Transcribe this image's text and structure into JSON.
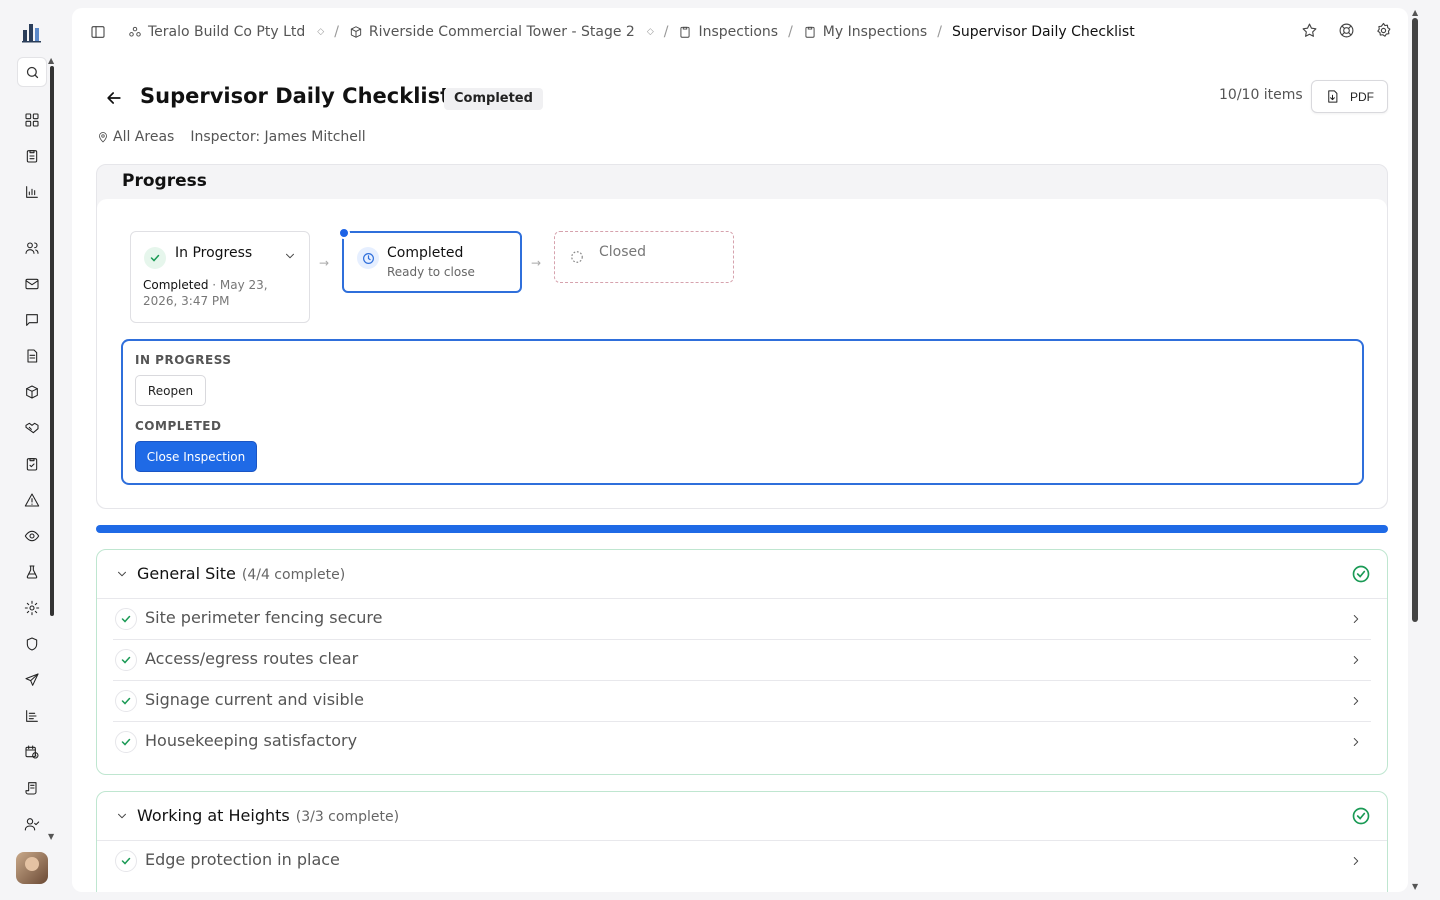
{
  "breadcrumbs": [
    {
      "label": "Teralo Build Co Pty Ltd",
      "icon": "org-icon",
      "selector": true
    },
    {
      "label": "Riverside Commercial Tower - Stage 2",
      "icon": "project-icon",
      "selector": true
    },
    {
      "label": "Inspections",
      "icon": "clipboard-icon"
    },
    {
      "label": "My Inspections",
      "icon": "clipboard-icon"
    },
    {
      "label": "Supervisor Daily Checklist",
      "current": true
    }
  ],
  "header": {
    "title": "Supervisor Daily Checklist",
    "status_badge": "Completed",
    "location": "All Areas",
    "inspector": "Inspector: James Mitchell",
    "item_count": "10/10 items",
    "pdf_label": "PDF"
  },
  "progress": {
    "heading": "Progress",
    "steps": [
      {
        "label": "In Progress",
        "sub_strong": "Completed",
        "sub_rest": " · May 23, 2026, 3:47 PM",
        "state": "done"
      },
      {
        "label": "Completed",
        "sub": "Ready to close",
        "state": "current"
      },
      {
        "label": "Closed",
        "state": "pending"
      }
    ],
    "action_groups": [
      {
        "heading": "IN PROGRESS",
        "button": "Reopen"
      },
      {
        "heading": "COMPLETED",
        "button": "Close Inspection"
      }
    ],
    "completion_fraction": 1.0
  },
  "sections": [
    {
      "title": "General Site",
      "count": "(4/4 complete)",
      "items": [
        "Site perimeter fencing secure",
        "Access/egress routes clear",
        "Signage current and visible",
        "Housekeeping satisfactory"
      ]
    },
    {
      "title": "Working at Heights",
      "count": "(3/3 complete)",
      "items": [
        "Edge protection in place"
      ]
    }
  ],
  "colors": {
    "accent": "#1f6ae6",
    "success": "#1a9a55",
    "section_border": "#bfe6d0"
  }
}
